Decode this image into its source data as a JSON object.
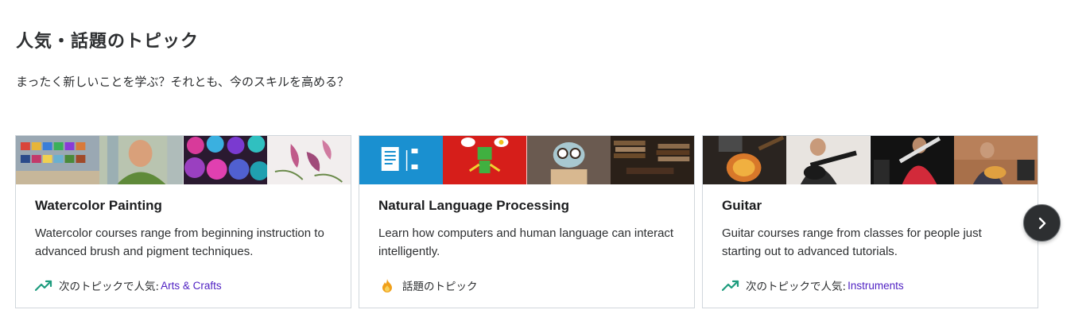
{
  "section": {
    "title": "人気・話題のトピック",
    "subtitle": "まったく新しいことを学ぶ？それとも、今のスキルを高める？"
  },
  "cards": [
    {
      "title": "Watercolor Painting",
      "description": "Watercolor courses range from beginning instruction to advanced brush and pigment techniques.",
      "foot_text": "次のトピックで人気:",
      "foot_icon": "trending-up-icon",
      "foot_link": "Arts & Crafts",
      "thumb_colors": [
        "#8a9aa6",
        "#7f9b6a",
        "#7a3a8e",
        "#d9c6cc"
      ]
    },
    {
      "title": "Natural Language Processing",
      "description": "Learn how computers and human language can interact intelligently.",
      "foot_text": "話題のトピック",
      "foot_icon": "fire-icon",
      "foot_link": "",
      "thumb_colors": [
        "#1d8fd1",
        "#d8201c",
        "#5b5048",
        "#3b3128"
      ]
    },
    {
      "title": "Guitar",
      "description": "Guitar courses range from classes for people just starting out to advanced tutorials.",
      "foot_text": "次のトピックで人気:",
      "foot_icon": "trending-up-icon",
      "foot_link": "Instruments",
      "thumb_colors": [
        "#6b4a2e",
        "#3a3a3a",
        "#c8213a",
        "#8a6b4f"
      ]
    }
  ],
  "next_button": {
    "icon": "chevron-right-icon"
  },
  "colors": {
    "link": "#5022c3",
    "trend": "#1e9c7e",
    "fire": "#f0a01a"
  }
}
